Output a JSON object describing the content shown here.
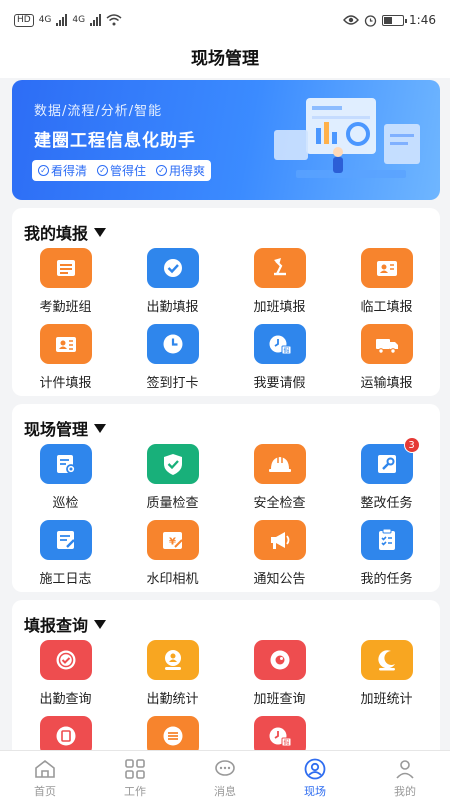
{
  "status": {
    "time": "1:46",
    "net1": "4G",
    "net2": "4G",
    "hd": "HD"
  },
  "header": {
    "title": "现场管理"
  },
  "banner": {
    "tag": "数据/流程/分析/智能",
    "headline": "建圈工程信息化助手",
    "pills": [
      "看得清",
      "管得住",
      "用得爽"
    ]
  },
  "sections": [
    {
      "title": "我的填报",
      "items": [
        {
          "label": "考勤班组",
          "icon": "roster-icon",
          "color": "#f7842d"
        },
        {
          "label": "出勤填报",
          "icon": "check-icon",
          "color": "#2f86ec"
        },
        {
          "label": "加班填报",
          "icon": "lamp-icon",
          "color": "#f7842d"
        },
        {
          "label": "临工填报",
          "icon": "worker-card-icon",
          "color": "#f7842d"
        },
        {
          "label": "计件填报",
          "icon": "piecework-icon",
          "color": "#f7842d"
        },
        {
          "label": "签到打卡",
          "icon": "clock-icon",
          "color": "#2f86ec"
        },
        {
          "label": "我要请假",
          "icon": "leave-icon",
          "color": "#2f86ec"
        },
        {
          "label": "运输填报",
          "icon": "truck-icon",
          "color": "#f7842d"
        }
      ]
    },
    {
      "title": "现场管理",
      "items": [
        {
          "label": "巡检",
          "icon": "inspect-icon",
          "color": "#2f86ec"
        },
        {
          "label": "质量检查",
          "icon": "shield-check-icon",
          "color": "#18b07a"
        },
        {
          "label": "安全检查",
          "icon": "helmet-icon",
          "color": "#f7842d"
        },
        {
          "label": "整改任务",
          "icon": "wrench-icon",
          "color": "#2f86ec",
          "badge": "3"
        },
        {
          "label": "施工日志",
          "icon": "log-icon",
          "color": "#2f86ec"
        },
        {
          "label": "水印相机",
          "icon": "camera-icon",
          "color": "#f7842d"
        },
        {
          "label": "通知公告",
          "icon": "megaphone-icon",
          "color": "#f7842d"
        },
        {
          "label": "我的任务",
          "icon": "clipboard-icon",
          "color": "#2f86ec"
        }
      ]
    },
    {
      "title": "填报查询",
      "items": [
        {
          "label": "出勤查询",
          "icon": "check-query-icon",
          "color": "#ee4d4f"
        },
        {
          "label": "出勤统计",
          "icon": "person-stat-icon",
          "color": "#f8a621"
        },
        {
          "label": "加班查询",
          "icon": "eye-query-icon",
          "color": "#ee4d4f"
        },
        {
          "label": "加班统计",
          "icon": "moon-stat-icon",
          "color": "#f8a621"
        },
        {
          "label": "",
          "icon": "doc-query-icon",
          "color": "#ee4d4f"
        },
        {
          "label": "",
          "icon": "list-stat-icon",
          "color": "#f7842d"
        },
        {
          "label": "",
          "icon": "leave-query-icon",
          "color": "#ee4d4f"
        }
      ]
    }
  ],
  "tabbar": [
    {
      "label": "首页",
      "icon": "home-icon",
      "active": false
    },
    {
      "label": "工作",
      "icon": "grid-icon",
      "active": false
    },
    {
      "label": "消息",
      "icon": "chat-icon",
      "active": false
    },
    {
      "label": "现场",
      "icon": "site-icon",
      "active": true
    },
    {
      "label": "我的",
      "icon": "profile-icon",
      "active": false
    }
  ]
}
